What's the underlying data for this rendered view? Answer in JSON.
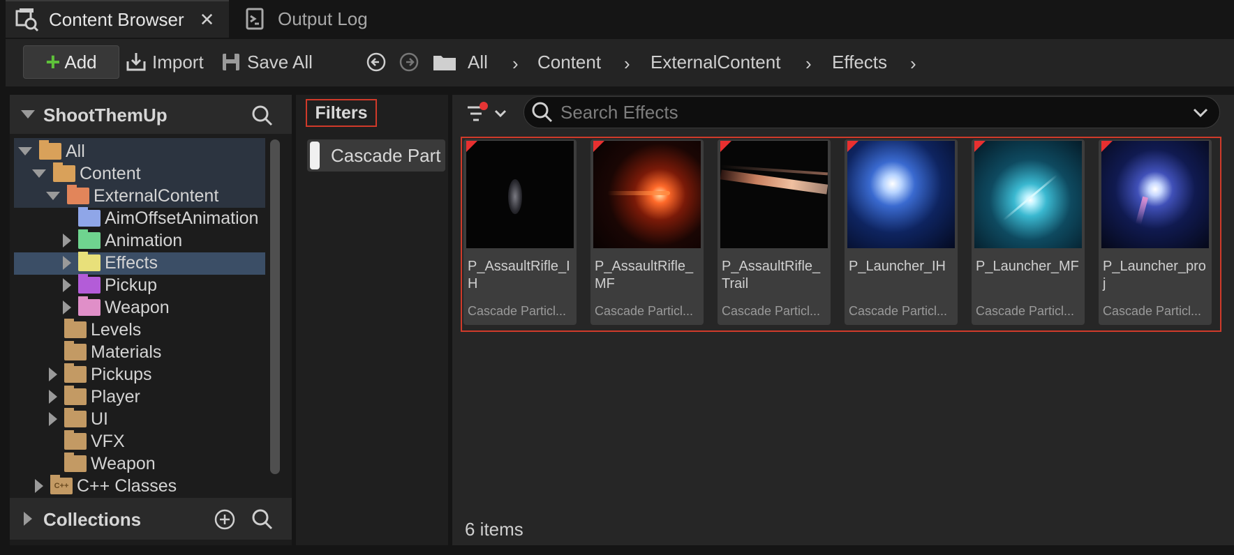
{
  "tabs": [
    {
      "label": "Content Browser",
      "icon": "content-browser-icon",
      "close": "✕"
    },
    {
      "label": "Output Log",
      "icon": "output-log-icon"
    }
  ],
  "toolbar": {
    "add_label": "Add",
    "import_label": "Import",
    "save_all_label": "Save All"
  },
  "breadcrumb": [
    "All",
    "Content",
    "ExternalContent",
    "Effects"
  ],
  "tree": {
    "project": "ShootThemUp",
    "items": [
      {
        "label": "All",
        "color": "#d9a15a",
        "open": true
      },
      {
        "label": "Content",
        "color": "#d9a15a",
        "open": true
      },
      {
        "label": "ExternalContent",
        "color": "#e2855a",
        "open": true
      },
      {
        "label": "AimOffsetAnimation",
        "color": "#8fa6e8"
      },
      {
        "label": "Animation",
        "color": "#6fd48f"
      },
      {
        "label": "Effects",
        "color": "#e8e07a",
        "selected": true
      },
      {
        "label": "Pickup",
        "color": "#b35cd8"
      },
      {
        "label": "Weapon",
        "color": "#e08fc8"
      },
      {
        "label": "Levels",
        "color": "#c39a64"
      },
      {
        "label": "Materials",
        "color": "#c39a64"
      },
      {
        "label": "Pickups",
        "color": "#c39a64"
      },
      {
        "label": "Player",
        "color": "#c39a64"
      },
      {
        "label": "UI",
        "color": "#c39a64"
      },
      {
        "label": "VFX",
        "color": "#c39a64"
      },
      {
        "label": "Weapon",
        "color": "#c39a64"
      },
      {
        "label": "C++ Classes",
        "color": "#c39a64",
        "badge": "C++"
      }
    ]
  },
  "collections_label": "Collections",
  "filters": {
    "label": "Filters",
    "chip": "Cascade Part"
  },
  "search": {
    "placeholder": "Search Effects"
  },
  "assets": [
    {
      "name": "P_AssaultRifle_IH",
      "type": "Cascade Particl..."
    },
    {
      "name": "P_AssaultRifle_MF",
      "type": "Cascade Particl..."
    },
    {
      "name": "P_AssaultRifle_Trail",
      "type": "Cascade Particl..."
    },
    {
      "name": "P_Launcher_IH",
      "type": "Cascade Particl..."
    },
    {
      "name": "P_Launcher_MF",
      "type": "Cascade Particl..."
    },
    {
      "name": "P_Launcher_proj",
      "type": "Cascade Particl..."
    }
  ],
  "item_count": "6 items"
}
